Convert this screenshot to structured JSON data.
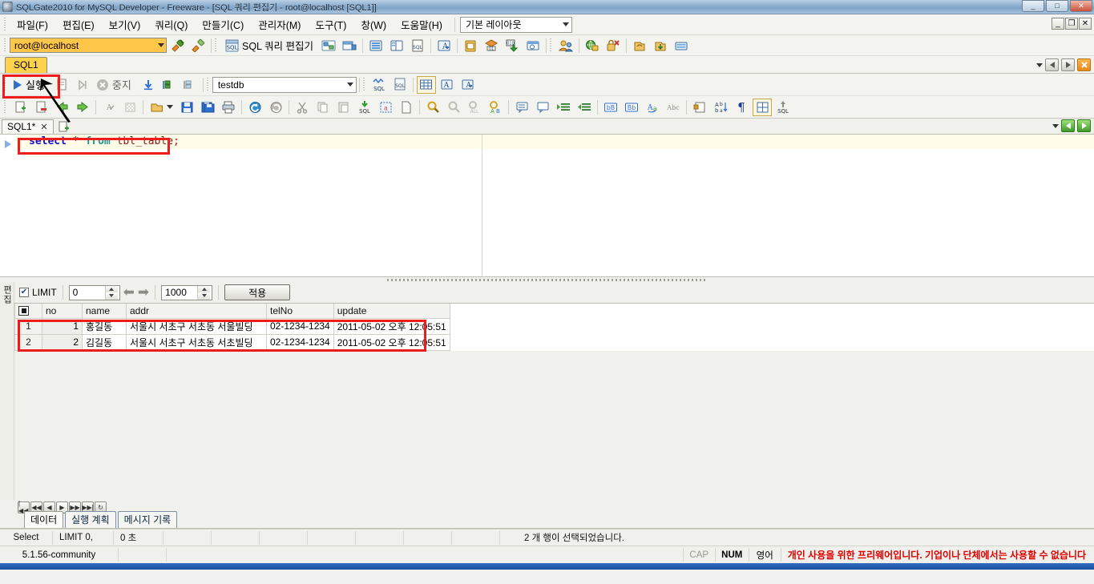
{
  "window": {
    "title": "SQLGate2010 for MySQL Developer - Freeware - [SQL 쿼리 편집기 - root@localhost [SQL1]]",
    "minimize": "_",
    "maximize": "□",
    "close": "✕",
    "mdi_minimize": "_",
    "mdi_restore": "❐",
    "mdi_close": "✕"
  },
  "menu": {
    "items": [
      {
        "label": "파일(F)",
        "name": "menu-file"
      },
      {
        "label": "편집(E)",
        "name": "menu-edit"
      },
      {
        "label": "보기(V)",
        "name": "menu-view"
      },
      {
        "label": "쿼리(Q)",
        "name": "menu-query"
      },
      {
        "label": "만들기(C)",
        "name": "menu-create"
      },
      {
        "label": "관리자(M)",
        "name": "menu-admin"
      },
      {
        "label": "도구(T)",
        "name": "menu-tools"
      },
      {
        "label": "창(W)",
        "name": "menu-window"
      },
      {
        "label": "도움말(H)",
        "name": "menu-help"
      }
    ],
    "layout_combo": "기본 레이아웃"
  },
  "connection_bar": {
    "connection": "root@localhost",
    "sql_editor_button": "SQL 쿼리 편집기"
  },
  "doc_tabs": {
    "active": "SQL1"
  },
  "exec_bar": {
    "run_label": "실행",
    "stop_label": "중지",
    "database": "testdb"
  },
  "editor": {
    "tab_label": "SQL1*",
    "tab_close": "✕",
    "sql_tokens": {
      "select": "select",
      "star": "*",
      "from": "from",
      "table": "tbl_table",
      "semicolon": ";"
    },
    "sql_full": "select * from tbl_table;"
  },
  "result_panel": {
    "vertical_label": "편집",
    "limit_label": "LIMIT",
    "limit_offset": "0",
    "limit_count": "1000",
    "apply_label": "적용"
  },
  "grid": {
    "columns": [
      "no",
      "name",
      "addr",
      "telNo",
      "update"
    ],
    "rows": [
      {
        "rownum": "1",
        "no": "1",
        "name": "홍길동",
        "addr": "서울시 서초구 서초동 서울빌딩",
        "telNo": "02-1234-1234",
        "update": "2011-05-02 오후 12:05:51"
      },
      {
        "rownum": "2",
        "no": "2",
        "name": "김길동",
        "addr": "서울시 서초구 서초동 서초빌딩",
        "telNo": "02-1234-1234",
        "update": "2011-05-02 오후 12:05:51"
      }
    ]
  },
  "bottom_nav": {
    "first": "|◀◀",
    "prev_page": "◀◀",
    "prev": "◀",
    "play": "▶",
    "next": "▶▶",
    "last": "▶▶|",
    "refresh": "↻"
  },
  "bottom_tabs": [
    {
      "label": "데이터",
      "name": "tab-data",
      "active": true
    },
    {
      "label": "실행 계획",
      "name": "tab-exec-plan",
      "active": false
    },
    {
      "label": "메시지 기록",
      "name": "tab-message-log",
      "active": false
    }
  ],
  "status": {
    "statement": "Select",
    "limit": "LIMIT 0,",
    "elapsed": "0 초",
    "rows_message": "2 개 행이 선택되었습니다.",
    "version": "5.1.56-community",
    "cap": "CAP",
    "num": "NUM",
    "lang": "영어",
    "license_warning": "개인 사용을 위한 프리웨어입니다. 기업이나 단체에서는 사용할 수 없습니다"
  },
  "colors": {
    "accent_orange": "#ffd24d",
    "connection_bg": "#ffc64a",
    "highlight_red": "#ee1c1c",
    "warning_red": "#e00000",
    "keyword_blue": "#1010c8",
    "keyword_teal": "#1f9a8a",
    "identifier_maroon": "#8b1a1a"
  }
}
